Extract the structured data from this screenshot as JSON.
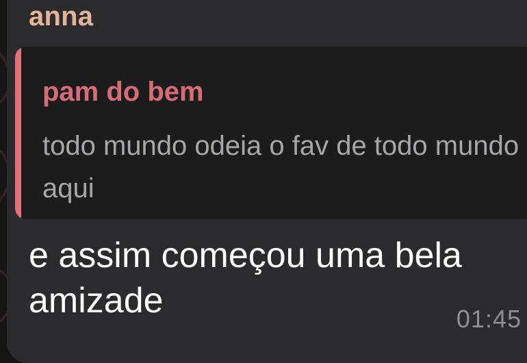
{
  "colors": {
    "bubble_bg": "#2b2b2d",
    "sender_name": "#e3b497",
    "reply_accent": "#e36f7a",
    "reply_name": "#d66d76",
    "reply_text": "#a7a7aa",
    "message_text": "#ffffff",
    "time_text": "#8f8f93"
  },
  "message": {
    "sender": "anna",
    "reply": {
      "author": "pam do bem",
      "text": "todo mundo odeia o fav de todo mundo aqui"
    },
    "text": "e assim começou uma bela amizade",
    "time": "01:45"
  }
}
